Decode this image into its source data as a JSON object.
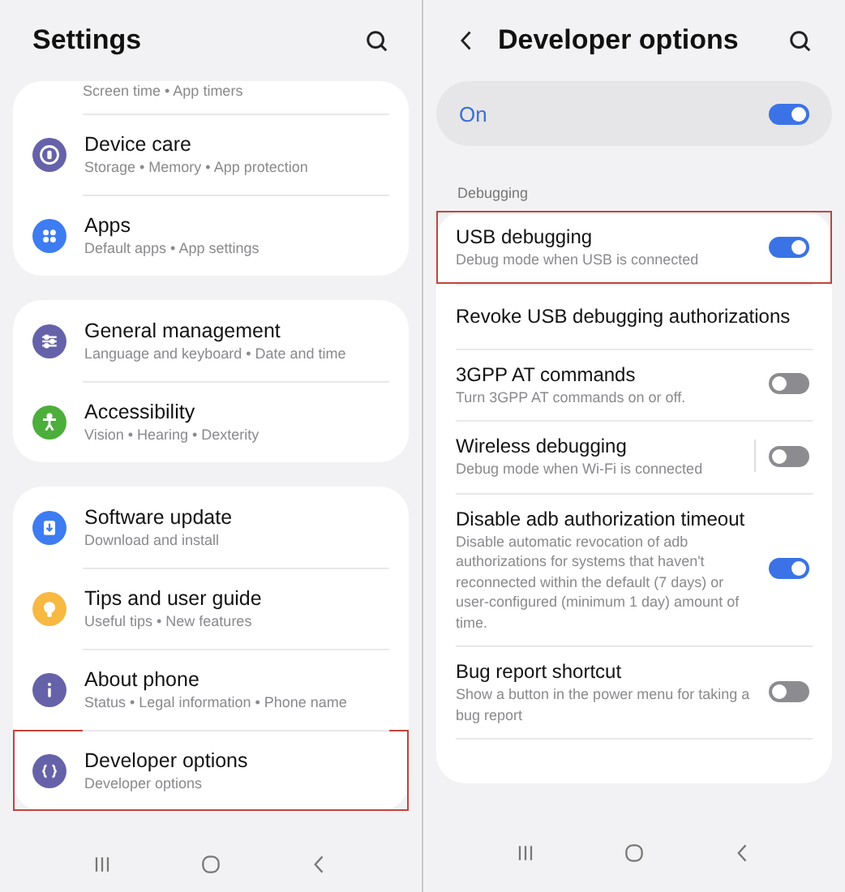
{
  "left": {
    "title": "Settings",
    "groups": [
      {
        "items": [
          {
            "kind": "partial",
            "subtitle": "Screen time • App timers",
            "highlighted": false
          },
          {
            "kind": "device-care",
            "color": "#6662a9",
            "title": "Device care",
            "subtitle": "Storage • Memory • App protection",
            "highlighted": false
          },
          {
            "kind": "apps",
            "color": "#3d7cf1",
            "title": "Apps",
            "subtitle": "Default apps • App settings",
            "highlighted": false
          }
        ]
      },
      {
        "items": [
          {
            "kind": "general",
            "color": "#6662a9",
            "title": "General management",
            "subtitle": "Language and keyboard • Date and time",
            "highlighted": false
          },
          {
            "kind": "accessibility",
            "color": "#4cae3b",
            "title": "Accessibility",
            "subtitle": "Vision • Hearing • Dexterity",
            "highlighted": false
          }
        ]
      },
      {
        "items": [
          {
            "kind": "update",
            "color": "#3d7cf1",
            "title": "Software update",
            "subtitle": "Download and install",
            "highlighted": false
          },
          {
            "kind": "tips",
            "color": "#f7b942",
            "title": "Tips and user guide",
            "subtitle": "Useful tips • New features",
            "highlighted": false
          },
          {
            "kind": "about",
            "color": "#6662a9",
            "title": "About phone",
            "subtitle": "Status • Legal information • Phone name",
            "highlighted": false
          },
          {
            "kind": "developer",
            "color": "#6662a9",
            "title": "Developer options",
            "subtitle": "Developer options",
            "highlighted": true
          }
        ]
      }
    ]
  },
  "right": {
    "title": "Developer options",
    "master": {
      "label": "On",
      "on": true
    },
    "section": "Debugging",
    "rows": [
      {
        "kind": "toggle",
        "title": "USB debugging",
        "subtitle": "Debug mode when USB is connected",
        "on": true,
        "highlighted": true,
        "separator": false
      },
      {
        "kind": "plain",
        "title": "Revoke USB debugging authorizations",
        "highlighted": false
      },
      {
        "kind": "toggle",
        "title": "3GPP AT commands",
        "subtitle": "Turn 3GPP AT commands on or off.",
        "on": false,
        "highlighted": false,
        "separator": false
      },
      {
        "kind": "toggle",
        "title": "Wireless debugging",
        "subtitle": "Debug mode when Wi-Fi is connected",
        "on": false,
        "highlighted": false,
        "separator": true
      },
      {
        "kind": "toggle",
        "title": "Disable adb authorization timeout",
        "subtitle": "Disable automatic revocation of adb authorizations for systems that haven't reconnected within the default (7 days) or user-configured (minimum 1 day) amount of time.",
        "on": true,
        "highlighted": false,
        "separator": false
      },
      {
        "kind": "toggle",
        "title": "Bug report shortcut",
        "subtitle": "Show a button in the power menu for taking a bug report",
        "on": false,
        "highlighted": false,
        "separator": false
      }
    ]
  }
}
